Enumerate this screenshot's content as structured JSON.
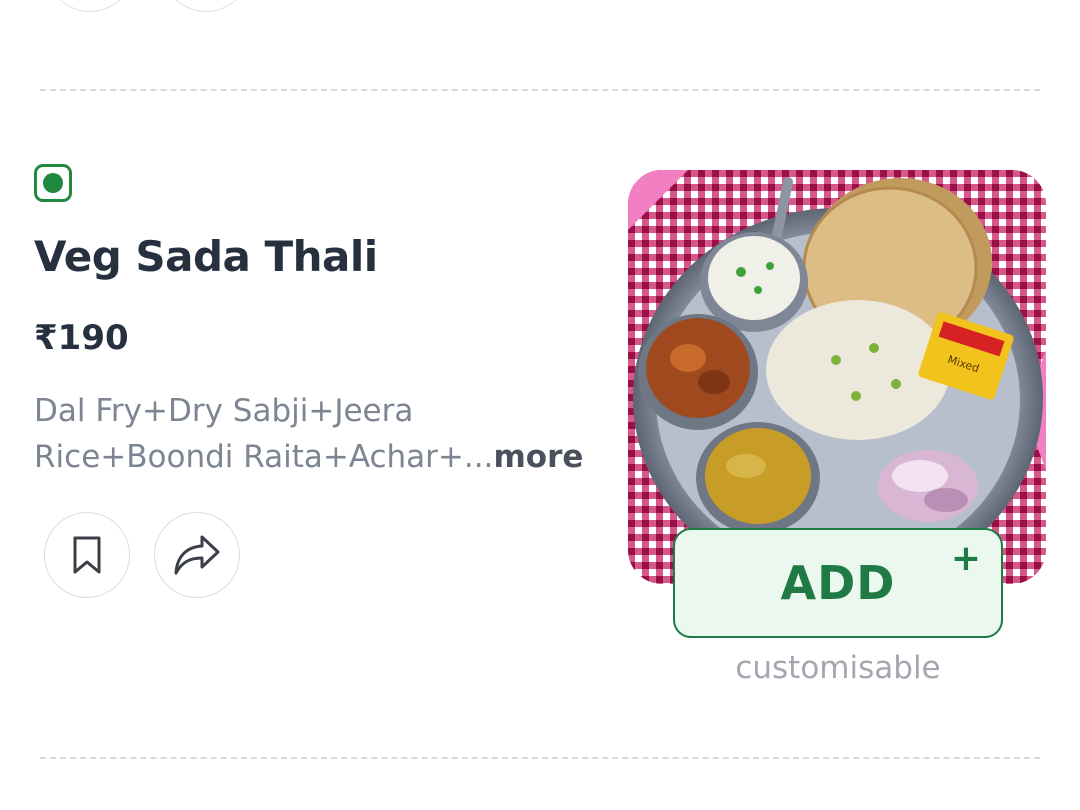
{
  "colors": {
    "veg_green": "#21893f",
    "add_green": "#1f7a45",
    "add_bg": "#eaf8ef",
    "title_text": "#27303f",
    "desc_text": "#7d8593"
  },
  "item": {
    "veg_icon": "veg-indicator-icon",
    "name": "Veg Sada Thali",
    "price": "₹190",
    "description": "Dal Fry+Dry Sabji+Jeera Rice+Boondi Raita+Achar+...",
    "more_label": "more",
    "bookmark_icon": "bookmark-icon",
    "share_icon": "share-icon",
    "add_label": "ADD",
    "add_plus": "+",
    "customisable_note": "customisable",
    "image_pack_label": "Mixed"
  }
}
